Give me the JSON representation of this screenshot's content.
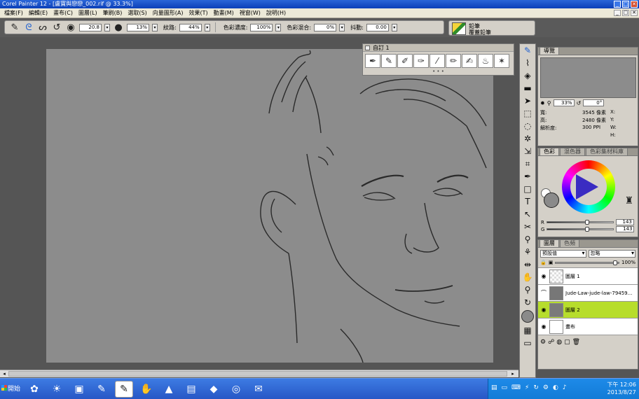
{
  "window": {
    "title": "Corel Painter 12 - [盧寶與戀戀_002.rif @ 33.3%]",
    "min": "_",
    "max": "□",
    "close": "✕"
  },
  "menu": [
    "檔案(F)",
    "編輯(E)",
    "畫布(C)",
    "圖層(L)",
    "筆刷(B)",
    "選取(S)",
    "向量圖形(A)",
    "效果(T)",
    "動畫(M)",
    "視窗(W)",
    "說明(H)"
  ],
  "propbar": {
    "size_value": "20.8",
    "opacity_value": "13%",
    "grain_label": "紋路:",
    "grain_value": "44%",
    "resat_label": "色彩濃度:",
    "resat_value": "100%",
    "bleed_label": "色彩混合:",
    "bleed_value": "0%",
    "jitter_label": "抖動:",
    "jitter_value": "0.00"
  },
  "brush": {
    "category": "鉛筆",
    "variant": "覆蓋鉛筆"
  },
  "custom_palette": {
    "title": "自訂 1"
  },
  "navigator": {
    "tab": "導覽",
    "zoom": "33%",
    "angle": "0°"
  },
  "info": {
    "width_label": "寬:",
    "width_value": "3545 像素",
    "height_label": "高:",
    "height_value": "2480 像素",
    "res_label": "解析度:",
    "res_value": "300 PPI",
    "x_label": "X:",
    "y_label": "Y:",
    "w_label": "W:",
    "h_label": "H:"
  },
  "color_panel": {
    "tabs": [
      "色彩",
      "混色器",
      "色彩集材料庫"
    ],
    "r_label": "R",
    "r_value": "143",
    "g_label": "G",
    "g_value": "143"
  },
  "layers_panel": {
    "tabs": [
      "圖層",
      "色頻"
    ],
    "composite": "預設值",
    "method": "忽略",
    "opacity": "100%",
    "layers": [
      {
        "name": "圖層 1",
        "thumb": "transparent",
        "selected": false
      },
      {
        "name": "Jude-Law-jude-law-79459...",
        "thumb": "photo",
        "selected": false
      },
      {
        "name": "圖層 2",
        "thumb": "gray",
        "selected": true
      },
      {
        "name": "畫布",
        "thumb": "white",
        "selected": false
      }
    ]
  },
  "taskbar": {
    "start": "開始",
    "clock_time": "下午 12:06",
    "clock_date": "2013/8/27"
  }
}
